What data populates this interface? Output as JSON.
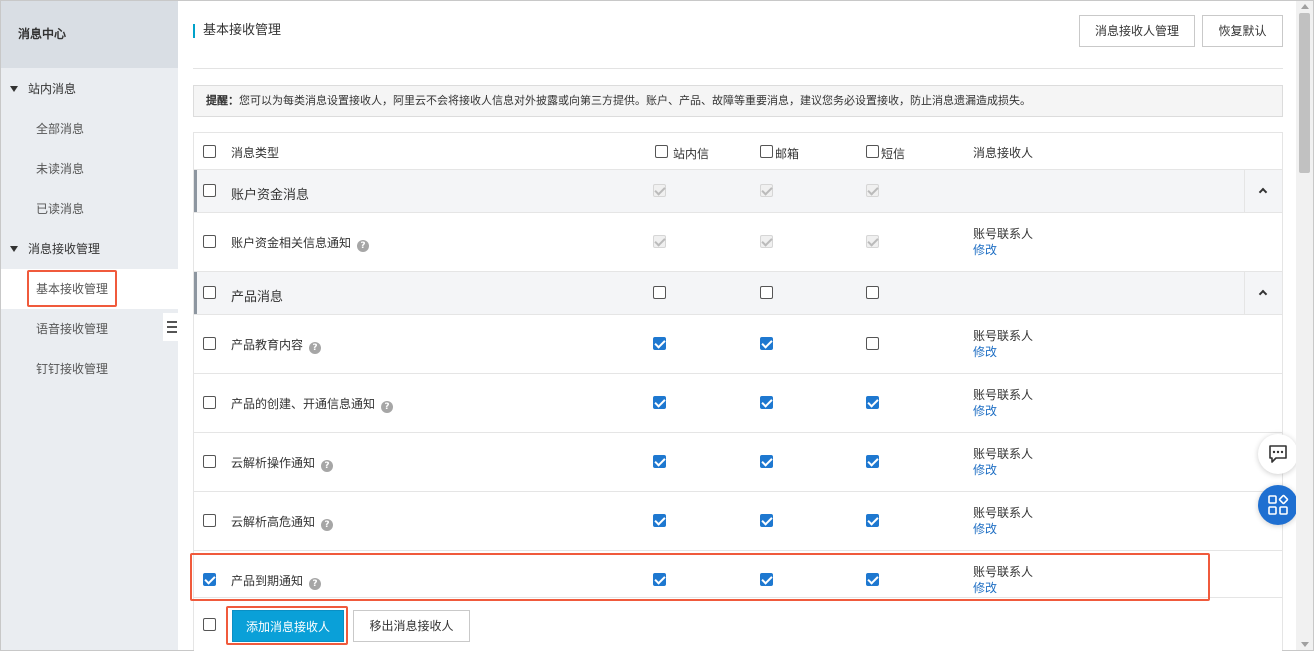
{
  "sidebar": {
    "title": "消息中心",
    "groups": [
      {
        "label": "站内消息",
        "items": [
          "全部消息",
          "未读消息",
          "已读消息"
        ]
      },
      {
        "label": "消息接收管理",
        "items": [
          "基本接收管理",
          "语音接收管理",
          "钉钉接收管理"
        ]
      }
    ],
    "active_item": "基本接收管理"
  },
  "header": {
    "title": "基本接收管理",
    "btn_manage": "消息接收人管理",
    "btn_reset": "恢复默认"
  },
  "notice": {
    "label": "提醒：",
    "text": "您可以为每类消息设置接收人，阿里云不会将接收人信息对外披露或向第三方提供。账户、产品、故障等重要消息，建议您务必设置接收，防止消息遗漏造成损失。"
  },
  "table": {
    "headers": {
      "type": "消息类型",
      "site": "站内信",
      "email": "邮箱",
      "sms": "短信",
      "receiver": "消息接收人"
    },
    "rows": [
      {
        "kind": "group",
        "name": "账户资金消息",
        "selected": false,
        "site": "disabled",
        "email": "disabled",
        "sms": "disabled"
      },
      {
        "kind": "item",
        "name": "账户资金相关信息通知",
        "selected": false,
        "site": "disabled",
        "email": "disabled",
        "sms": "disabled",
        "receiver": "账号联系人",
        "edit": "修改"
      },
      {
        "kind": "group",
        "name": "产品消息",
        "selected": false,
        "site": "off",
        "email": "off",
        "sms": "off"
      },
      {
        "kind": "item",
        "name": "产品教育内容",
        "selected": false,
        "site": "on",
        "email": "on",
        "sms": "off",
        "receiver": "账号联系人",
        "edit": "修改"
      },
      {
        "kind": "item",
        "name": "产品的创建、开通信息通知",
        "selected": false,
        "site": "on",
        "email": "on",
        "sms": "on",
        "receiver": "账号联系人",
        "edit": "修改"
      },
      {
        "kind": "item",
        "name": "云解析操作通知",
        "selected": false,
        "site": "on",
        "email": "on",
        "sms": "on",
        "receiver": "账号联系人",
        "edit": "修改"
      },
      {
        "kind": "item",
        "name": "云解析高危通知",
        "selected": false,
        "site": "on",
        "email": "on",
        "sms": "on",
        "receiver": "账号联系人",
        "edit": "修改"
      },
      {
        "kind": "item",
        "name": "产品到期通知",
        "selected": true,
        "site": "on",
        "email": "on",
        "sms": "on",
        "receiver": "账号联系人",
        "edit": "修改"
      }
    ]
  },
  "footer": {
    "btn_add": "添加消息接收人",
    "btn_remove": "移出消息接收人"
  },
  "help_icon": "question-circle-icon",
  "colors": {
    "accent": "#0aa0d8",
    "highlight": "#f05a3c",
    "checkbox": "#1e78d0",
    "link": "#1f6fc4"
  }
}
